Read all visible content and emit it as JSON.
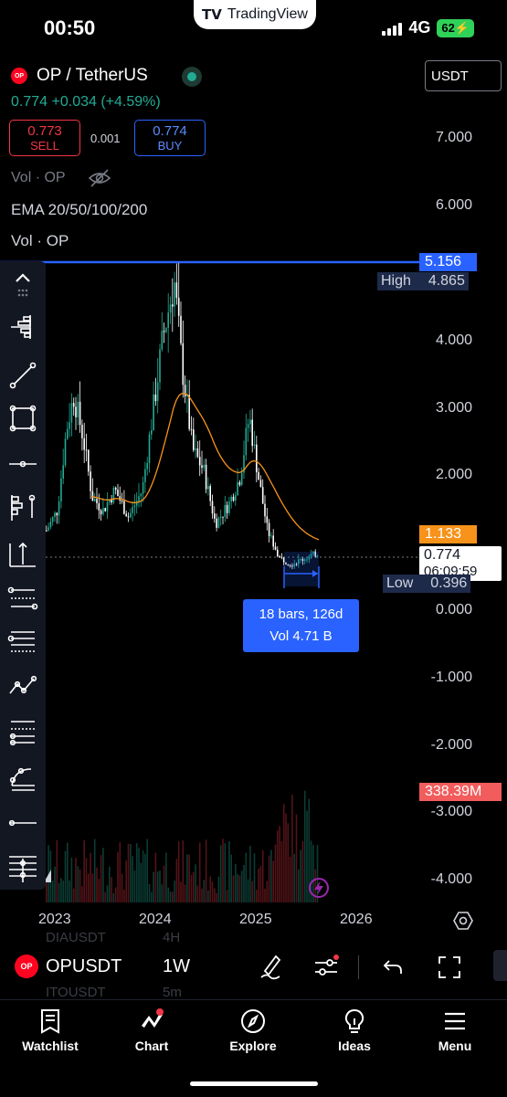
{
  "status_bar": {
    "time": "00:50",
    "network": "4G",
    "battery": "62",
    "app_pill": "TradingView"
  },
  "symbol": {
    "logo": "OP",
    "title": "OP / TetherUS",
    "last": "0.774",
    "change": "+0.034",
    "change_pct": "(+4.59%)",
    "sell_price": "0.773",
    "sell_label": "SELL",
    "buy_price": "0.774",
    "buy_label": "BUY",
    "spread": "0.001",
    "currency": "USDT"
  },
  "indicators": {
    "vol_hidden": "Vol · OP",
    "ema": "EMA 20/50/100/200",
    "vol": "Vol · OP"
  },
  "price_axis": {
    "ticks": [
      "7.000",
      "6.000",
      "4.000",
      "3.000",
      "2.000",
      "0.000",
      "-1.000",
      "-2.000",
      "-3.000",
      "-4.000"
    ],
    "h_line_value": "5.156",
    "high_label": "High",
    "high_value": "4.865",
    "ema_value": "1.133",
    "current_price": "0.774",
    "countdown": "06:09:59",
    "low_label": "Low",
    "low_value": "0.396",
    "volume_value": "338.39M"
  },
  "measure": {
    "line1": "18 bars, 126d",
    "line2": "Vol 4.71 B"
  },
  "time_axis": [
    "2023",
    "2024",
    "2025",
    "2026"
  ],
  "symbol_bar": {
    "name": "OPUSDT",
    "timeframe": "1W",
    "ghost1": "DIAUSDT",
    "ghost1_tf": "4H",
    "ghost2": "ITOUSDT",
    "ghost2_tf": "5m"
  },
  "nav": [
    {
      "label": "Watchlist",
      "icon": "watchlist-icon"
    },
    {
      "label": "Chart",
      "icon": "chart-icon"
    },
    {
      "label": "Explore",
      "icon": "compass-icon"
    },
    {
      "label": "Ideas",
      "icon": "lightbulb-icon"
    },
    {
      "label": "Menu",
      "icon": "hamburger-icon"
    }
  ],
  "colors": {
    "up": "#22ab94",
    "down": "#f23645",
    "accent": "#2962ff",
    "ema": "#f7931a"
  }
}
